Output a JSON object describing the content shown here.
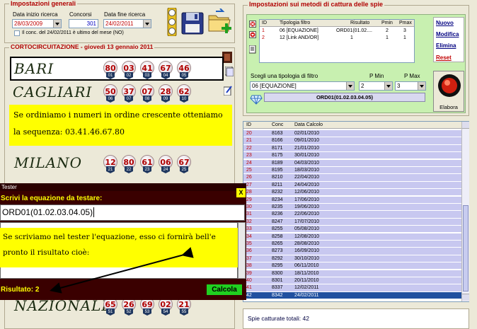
{
  "general": {
    "legend": "Impostazioni generali",
    "start_label": "Data inizio ricerca",
    "start_value": "28/03/2009",
    "concorsi_label": "Concorsi",
    "concorsi_value": "301",
    "end_label": "Data fine ricerca",
    "end_value": "24/02/2011",
    "last_month_label": "Il conc. del 24/02/2011 è ultimo del mese (NO)"
  },
  "shortcircuit": {
    "title": "CORTOCIRCUITAZIONE - giovedì 13 gennaio 2011",
    "rows": [
      {
        "city": "BARI",
        "balls": [
          {
            "n": "80",
            "t": "01"
          },
          {
            "n": "03",
            "t": "02"
          },
          {
            "n": "41",
            "t": "03"
          },
          {
            "n": "67",
            "t": "04"
          },
          {
            "n": "46",
            "t": "05"
          }
        ]
      },
      {
        "city": "CAGLIARI",
        "balls": [
          {
            "n": "50",
            "t": "06"
          },
          {
            "n": "37",
            "t": "07"
          },
          {
            "n": "07",
            "t": "08"
          },
          {
            "n": "28",
            "t": "09"
          },
          {
            "n": "62",
            "t": "10"
          }
        ]
      },
      {
        "city": "MILANO",
        "balls": [
          {
            "n": "12",
            "t": "21"
          },
          {
            "n": "80",
            "t": "22"
          },
          {
            "n": "61",
            "t": "23"
          },
          {
            "n": "06",
            "t": "24"
          },
          {
            "n": "67",
            "t": "25"
          }
        ]
      },
      {
        "city": "NAZIONALE",
        "balls": [
          {
            "n": "65",
            "t": "51"
          },
          {
            "n": "26",
            "t": "52"
          },
          {
            "n": "69",
            "t": "53"
          },
          {
            "n": "02",
            "t": "54"
          },
          {
            "n": "21",
            "t": "55"
          }
        ]
      }
    ],
    "note": "Se ordiniamo i numeri in ordine crescente otteniamo la sequenza: 03.41.46.67.80"
  },
  "spie": {
    "legend": "Impostazioni sui metodi di cattura delle spie",
    "headers": [
      "ID",
      "Tipologia filtro",
      "Risultato",
      "Pmin",
      "Pmax"
    ],
    "rows": [
      {
        "id": "1",
        "tipo": "06 [EQUAZIONE]",
        "ris": "ORD01(01.02....",
        "pmin": "2",
        "pmax": "3"
      },
      {
        "id": "2",
        "tipo": "12 [Link AND/OR]",
        "ris": "1",
        "pmin": "1",
        "pmax": "1"
      }
    ],
    "buttons": {
      "nuovo": "Nuovo",
      "modifica": "Modifica",
      "elimina": "Elimina",
      "reset": "Reset"
    },
    "filter_label": "Scegli una tipologia di filtro",
    "pmin_label": "P Min",
    "pmax_label": "P Max",
    "filter_value": "06 [EQUAZIONE]",
    "pmin_value": "2",
    "pmax_value": "3",
    "formula": "ORD01(01.02.03.04.05)",
    "elabora": "Elabora"
  },
  "results": {
    "headers": [
      "ID",
      "Conc",
      "Data Calcolo"
    ],
    "rows": [
      {
        "id": "20",
        "conc": "8163",
        "date": "02/01/2010"
      },
      {
        "id": "21",
        "conc": "8166",
        "date": "09/01/2010"
      },
      {
        "id": "22",
        "conc": "8171",
        "date": "21/01/2010"
      },
      {
        "id": "23",
        "conc": "8175",
        "date": "30/01/2010"
      },
      {
        "id": "24",
        "conc": "8189",
        "date": "04/03/2010"
      },
      {
        "id": "25",
        "conc": "8195",
        "date": "18/03/2010"
      },
      {
        "id": "26",
        "conc": "8210",
        "date": "22/04/2010"
      },
      {
        "id": "27",
        "conc": "8211",
        "date": "24/04/2010"
      },
      {
        "id": "28",
        "conc": "8232",
        "date": "12/06/2010"
      },
      {
        "id": "29",
        "conc": "8234",
        "date": "17/06/2010"
      },
      {
        "id": "30",
        "conc": "8235",
        "date": "19/06/2010"
      },
      {
        "id": "31",
        "conc": "8236",
        "date": "22/06/2010"
      },
      {
        "id": "32",
        "conc": "8247",
        "date": "17/07/2010"
      },
      {
        "id": "33",
        "conc": "8255",
        "date": "05/08/2010"
      },
      {
        "id": "34",
        "conc": "8258",
        "date": "12/08/2010"
      },
      {
        "id": "35",
        "conc": "8265",
        "date": "28/08/2010"
      },
      {
        "id": "36",
        "conc": "8273",
        "date": "16/09/2010"
      },
      {
        "id": "37",
        "conc": "8292",
        "date": "30/10/2010"
      },
      {
        "id": "38",
        "conc": "8295",
        "date": "06/11/2010"
      },
      {
        "id": "39",
        "conc": "8300",
        "date": "18/11/2010"
      },
      {
        "id": "40",
        "conc": "8301",
        "date": "20/11/2010"
      },
      {
        "id": "41",
        "conc": "8337",
        "date": "12/02/2011"
      },
      {
        "id": "42",
        "conc": "8342",
        "date": "24/02/2011"
      }
    ],
    "total": "Spie catturate totali: 42"
  },
  "tester": {
    "window_title": "Tester",
    "close": "X",
    "prompt": "Scrivi la equazione da testare:",
    "input_value": "ORD01(01.02.03.04.05)",
    "note": "Se scriviamo nel tester l'equazione, esso ci fornirà bell'e pronto il risultato cioè:",
    "result": "Risultato: 2",
    "calcola": "Calcola"
  },
  "colors": {
    "accent_red": "#b00000",
    "grid_blue": "#c8c8f0",
    "highlight": "#ffff00",
    "tester_bg": "#3a0000"
  },
  "icons": [
    "traffic-light-icon",
    "save-icon",
    "folder-add-icon",
    "delete-icon",
    "edit-icon",
    "diamond-icon",
    "record-icon",
    "copy-icon"
  ]
}
